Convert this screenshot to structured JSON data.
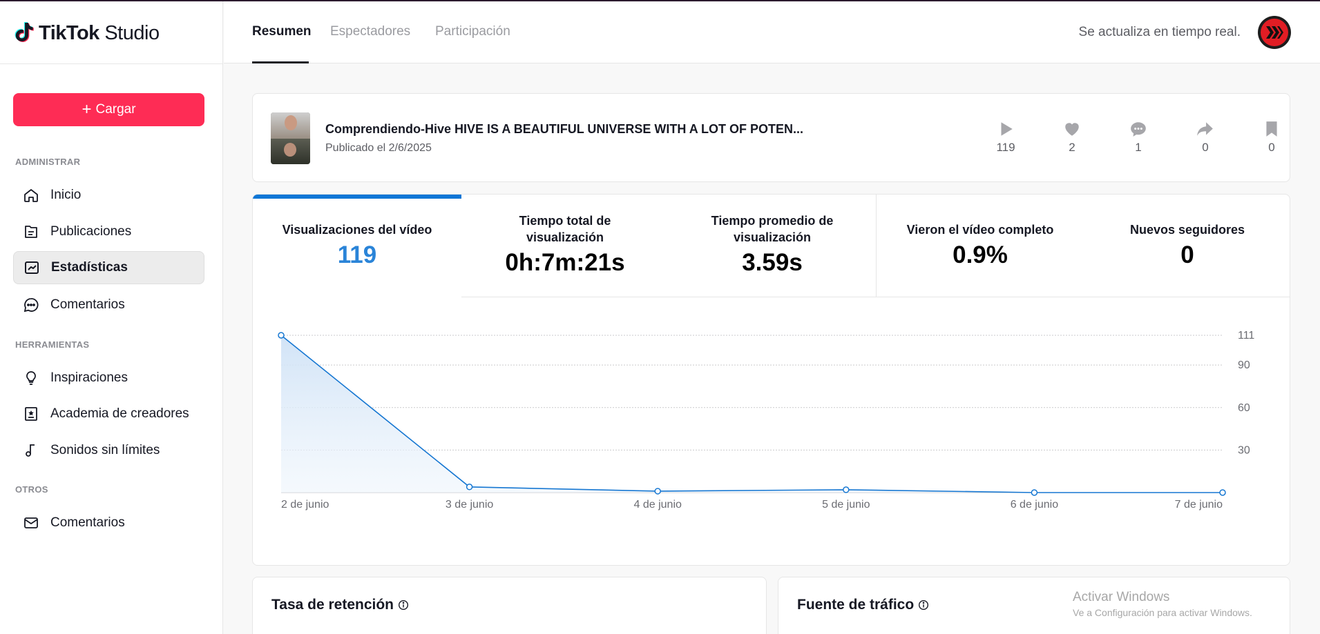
{
  "app": {
    "logo_brand": "TikTok",
    "logo_product": "Studio"
  },
  "sidebar": {
    "upload_label": "Cargar",
    "sections": [
      {
        "label": "ADMINISTRAR",
        "items": [
          {
            "label": "Inicio",
            "icon": "home-icon",
            "active": false
          },
          {
            "label": "Publicaciones",
            "icon": "folder-icon",
            "active": false
          },
          {
            "label": "Estadísticas",
            "icon": "analytics-icon",
            "active": true
          },
          {
            "label": "Comentarios",
            "icon": "comment-icon",
            "active": false
          }
        ]
      },
      {
        "label": "HERRAMIENTAS",
        "items": [
          {
            "label": "Inspiraciones",
            "icon": "lightbulb-icon",
            "active": false
          },
          {
            "label": "Academia de creadores",
            "icon": "academy-icon",
            "active": false
          },
          {
            "label": "Sonidos sin límites",
            "icon": "music-note-icon",
            "active": false
          }
        ]
      },
      {
        "label": "OTROS",
        "items": [
          {
            "label": "Comentarios",
            "icon": "envelope-icon",
            "active": false
          }
        ]
      }
    ]
  },
  "header": {
    "tabs": [
      {
        "label": "Resumen",
        "active": true
      },
      {
        "label": "Espectadores",
        "active": false
      },
      {
        "label": "Participación",
        "active": false
      }
    ],
    "realtime_text": "Se actualiza en tiempo real."
  },
  "video": {
    "title": "Comprendiendo-Hive HIVE IS A BEAUTIFUL UNIVERSE WITH A LOT OF POTEN...",
    "published": "Publicado el 2/6/2025",
    "stats": [
      {
        "icon": "play-icon",
        "value": "119"
      },
      {
        "icon": "heart-icon",
        "value": "2"
      },
      {
        "icon": "comment-bubble-icon",
        "value": "1"
      },
      {
        "icon": "share-icon",
        "value": "0"
      },
      {
        "icon": "bookmark-icon",
        "value": "0"
      }
    ]
  },
  "metrics": [
    {
      "label": "Visualizaciones del vídeo",
      "value": "119",
      "selected": true
    },
    {
      "label": "Tiempo total de visualización",
      "value": "0h:7m:21s",
      "selected": false
    },
    {
      "label": "Tiempo promedio de visualización",
      "value": "3.59s",
      "selected": false
    },
    {
      "label": "Vieron el vídeo completo",
      "value": "0.9%",
      "selected": false
    },
    {
      "label": "Nuevos seguidores",
      "value": "0",
      "selected": false
    }
  ],
  "chart_data": {
    "type": "area",
    "title": "",
    "xlabel": "",
    "ylabel": "",
    "categories": [
      "2 de junio",
      "3 de junio",
      "4 de junio",
      "5 de junio",
      "6 de junio",
      "7 de junio"
    ],
    "series": [
      {
        "values": [
          111,
          4,
          1,
          2,
          0,
          0
        ]
      }
    ],
    "y_ticks": [
      "111",
      "90",
      "60",
      "30"
    ],
    "y_tick_values": [
      111,
      90,
      60,
      30
    ],
    "ylim": [
      0,
      111
    ],
    "grid": true,
    "y_axis_side": "right",
    "color": "#1677d2"
  },
  "bottom_cards": {
    "retention_title": "Tasa de retención",
    "traffic_title": "Fuente de tráfico"
  },
  "watermark": {
    "line1": "Activar Windows",
    "line2": "Ve a Configuración para activar Windows."
  },
  "colors": {
    "accent": "#fe2c55",
    "chart_blue": "#1677d2",
    "active_bar": "#0e76d6"
  }
}
